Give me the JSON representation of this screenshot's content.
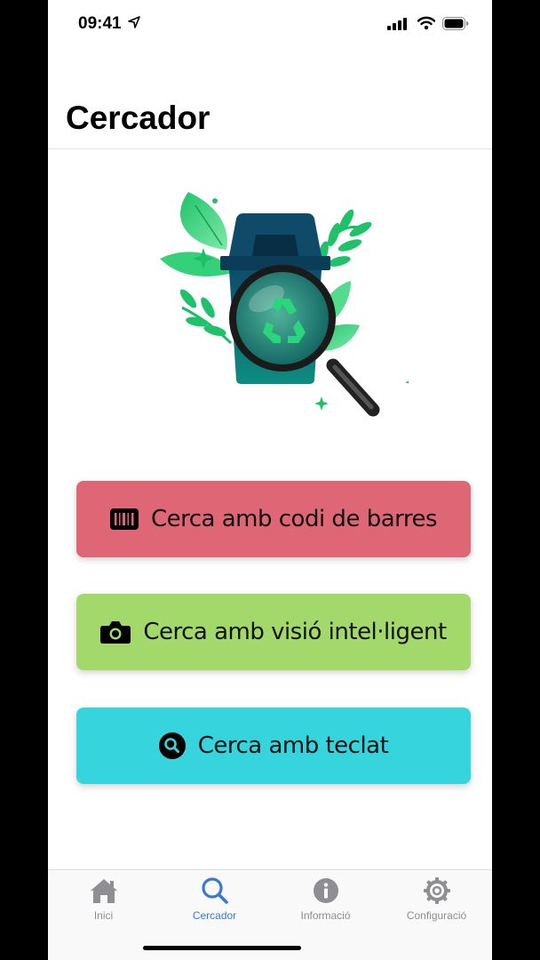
{
  "status_bar": {
    "time": "09:41"
  },
  "page": {
    "title": "Cercador"
  },
  "buttons": [
    {
      "label": "Cerca amb codi de barres",
      "icon": "barcode-icon",
      "color": "#de6675"
    },
    {
      "label": "Cerca amb visió intel·ligent",
      "icon": "camera-icon",
      "color": "#a3d96a"
    },
    {
      "label": "Cerca amb teclat",
      "icon": "search-icon",
      "color": "#36d5dd"
    }
  ],
  "tabbar": {
    "active": "Cercador",
    "tabs": [
      {
        "label": "Inici",
        "icon": "home-icon"
      },
      {
        "label": "Cercador",
        "icon": "search-icon"
      },
      {
        "label": "Informació",
        "icon": "info-icon"
      },
      {
        "label": "Configuració",
        "icon": "gear-icon"
      }
    ]
  },
  "colors": {
    "accent": "#3a78d8",
    "inactive": "#8e8e93"
  }
}
